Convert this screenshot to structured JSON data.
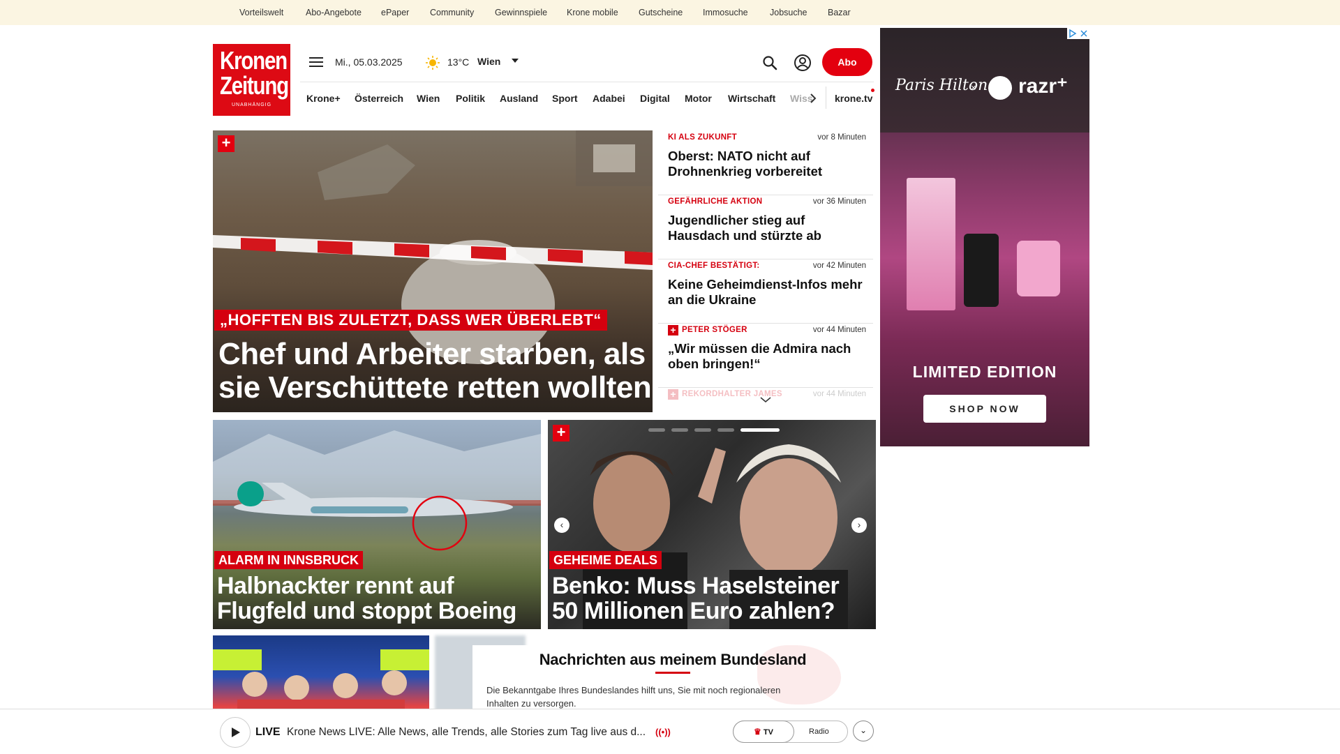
{
  "topbar": {
    "links": [
      "Vorteilswelt",
      "Abo-Angebote",
      "ePaper",
      "Community",
      "Gewinnspiele",
      "Krone mobile",
      "Gutscheine",
      "Immosuche",
      "Jobsuche",
      "Bazar"
    ]
  },
  "header": {
    "logo": {
      "line1": "Kronen",
      "line2": "Zeitung",
      "line3": "UNABHÄNGIG"
    },
    "date": "Mi., 05.03.2025",
    "temperature": "13°C",
    "city": "Wien",
    "abo_label": "Abo",
    "nav": [
      "Krone+",
      "Österreich",
      "Wien",
      "Politik",
      "Ausland",
      "Sport",
      "Adabei",
      "Digital",
      "Motor",
      "Wirtschaft",
      "Wiss"
    ],
    "tv_link": "krone.tv"
  },
  "hero": {
    "kicker": "„HOFFTEN BIS ZULETZT, DASS WER ÜBERLEBT“",
    "headline_1": "Chef und Arbeiter starben, als",
    "headline_2": "sie Verschüttete retten wollten"
  },
  "tickers": [
    {
      "category": "KI ALS ZUKUNFT",
      "time": "vor 8 Minuten",
      "title": "Oberst: NATO nicht auf Drohnenkrieg vorbereitet"
    },
    {
      "category": "GEFÄHRLICHE AKTION",
      "time": "vor 36 Minuten",
      "title": "Jugendlicher stieg auf Hausdach und stürzte ab"
    },
    {
      "category": "CIA-CHEF BESTÄTIGT:",
      "time": "vor 42 Minuten",
      "title": "Keine Geheimdienst-Infos mehr an die Ukraine"
    },
    {
      "category": "PETER STÖGER",
      "time": "vor 44 Minuten",
      "title": "„Wir müssen die Admira nach oben bringen!“"
    },
    {
      "category": "REKORDHALTER JAMES",
      "time": "vor 44 Minuten",
      "title": ""
    }
  ],
  "cards": [
    {
      "kicker": "ALARM IN INNSBRUCK",
      "headline_1": "Halbnackter rennt auf",
      "headline_2": "Flugfeld und stoppt Boeing"
    },
    {
      "kicker": "GEHEIME DEALS",
      "headline_1": "Benko: Muss Haselsteiner",
      "headline_2": "50 Millionen Euro zahlen?"
    }
  ],
  "ad": {
    "limited": "LIMITED EDITION",
    "shop": "SHOP NOW",
    "brand": "razr⁺",
    "signature": "Paris Hilton",
    "x": "×"
  },
  "bundesland": {
    "title": "Nachrichten aus meinem Bundesland",
    "text": "Die Bekanntgabe Ihres Bundeslandes hilft uns, Sie mit noch regionaleren Inhalten zu versorgen."
  },
  "livebar": {
    "live": "LIVE",
    "text": "Krone News LIVE: Alle News, alle Trends, alle Stories zum Tag live aus d...",
    "tv": "TV",
    "radio": "Radio"
  },
  "colors": {
    "brand_red": "#e3000f",
    "topbar_bg": "#fbf5e2"
  }
}
